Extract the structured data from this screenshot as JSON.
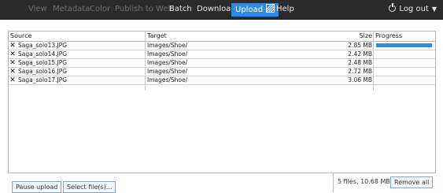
{
  "menu": {
    "view": "View",
    "metadata": "Metadata",
    "color": "Color",
    "publish": "Publish to Web",
    "batch": "Batch",
    "download": "Download",
    "upload": "Upload",
    "help": "Help",
    "logout": "Log out",
    "icons": {
      "upload": "striped-square-icon",
      "logout": "power-icon",
      "caret": "chevron-down-icon"
    }
  },
  "table": {
    "columns": [
      "Source",
      "Target",
      "Size",
      "Progress"
    ],
    "rows": [
      {
        "source": "Saga_solo13.JPG",
        "target": "Images/Shoe/",
        "size": "2.85 MB",
        "progress": 1.0
      },
      {
        "source": "Saga_solo14.JPG",
        "target": "Images/Shoe/",
        "size": "2.42 MB",
        "progress": 0
      },
      {
        "source": "Saga_solo15.JPG",
        "target": "Images/Shoe/",
        "size": "2.48 MB",
        "progress": 0
      },
      {
        "source": "Saga_solo16.JPG",
        "target": "Images/Shoe/",
        "size": "2.72 MB",
        "progress": 0
      },
      {
        "source": "Saga_solo17.JPG",
        "target": "Images/Shoe/",
        "size": "3.06 MB",
        "progress": 0
      }
    ],
    "remove_icon": "close-icon"
  },
  "footer": {
    "pause_label": "Pause upload",
    "select_label": "Select file(s)...",
    "summary": "5 files, 10.68 MB",
    "remove_all_label": "Remove all"
  },
  "colors": {
    "topbar": "#2b2b2b",
    "accent": "#2f8be2",
    "disabled_text": "#6e6e6e"
  }
}
